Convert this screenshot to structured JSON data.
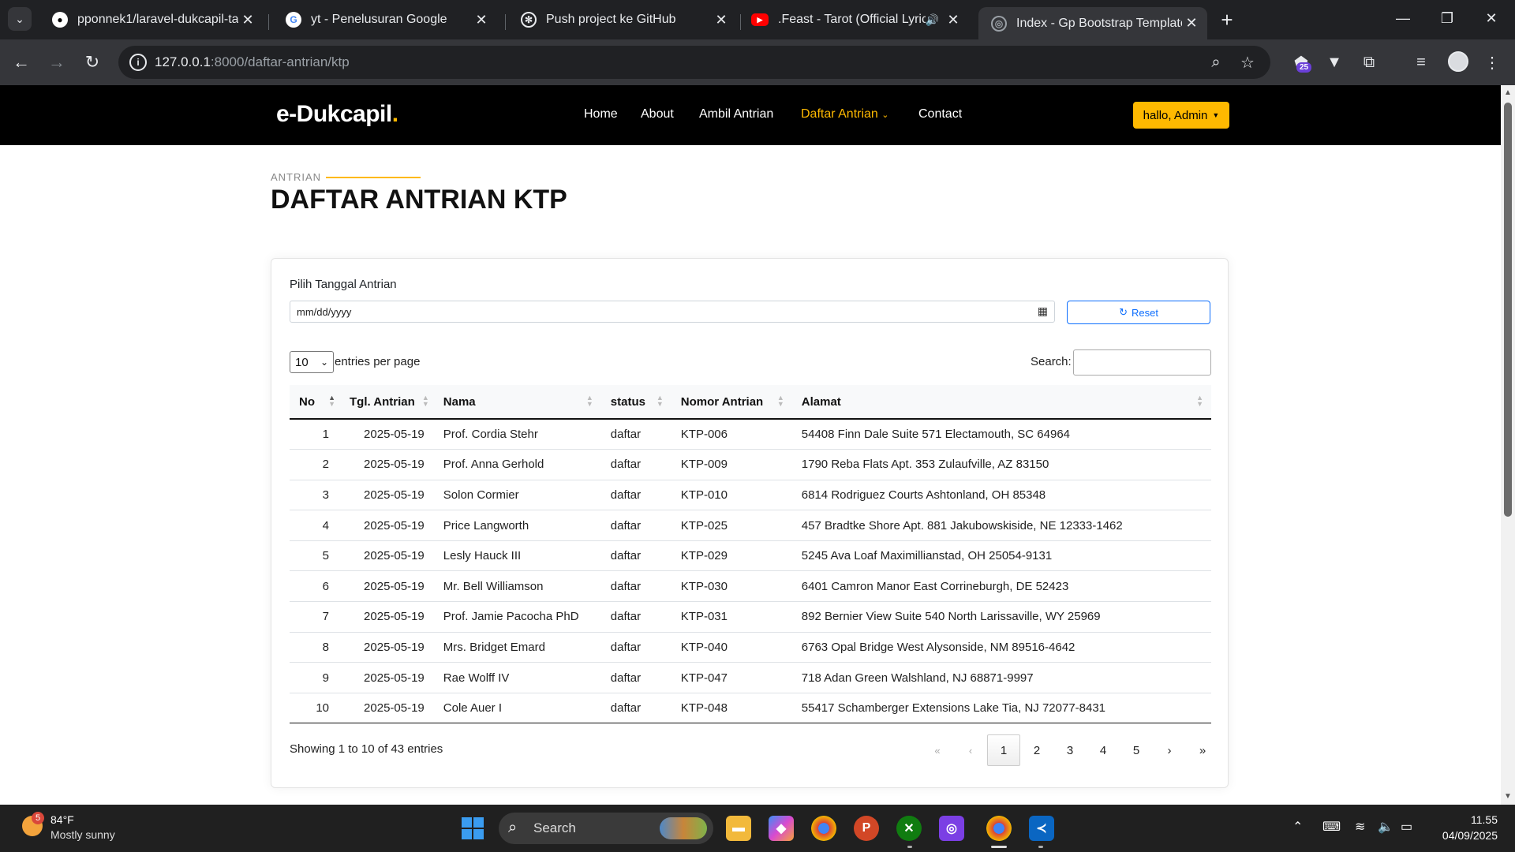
{
  "browser": {
    "tabs": [
      {
        "title": "pponnek1/laravel-dukcapil-ta",
        "icon": "github-icon"
      },
      {
        "title": "yt - Penelusuran Google",
        "icon": "google-icon"
      },
      {
        "title": "Push project ke GitHub",
        "icon": "chatgpt-icon"
      },
      {
        "title": ".Feast - Tarot (Official Lyric V",
        "icon": "youtube-icon"
      },
      {
        "title": "Index - Gp Bootstrap Template",
        "icon": "globe-icon"
      }
    ],
    "url_host": "127.0.0.1",
    "url_path": ":8000/daftar-antrian/ktp",
    "extension_badge": "25"
  },
  "site": {
    "logo": "e-Dukcapil",
    "logo_dot": ".",
    "nav": [
      "Home",
      "About",
      "Ambil Antrian",
      "Daftar Antrian",
      "Contact"
    ],
    "active_nav": "Daftar Antrian",
    "user_button": "hallo, Admin"
  },
  "page": {
    "eyebrow": "ANTRIAN",
    "title": "DAFTAR ANTRIAN KTP"
  },
  "filter": {
    "label": "Pilih Tanggal Antrian",
    "date_placeholder": "mm/dd/yyyy",
    "reset_label": "Reset"
  },
  "datatable": {
    "length_value": "10",
    "length_label": "entries per page",
    "search_label": "Search:",
    "columns": [
      "No",
      "Tgl. Antrian",
      "Nama",
      "status",
      "Nomor Antrian",
      "Alamat"
    ],
    "rows": [
      [
        "1",
        "2025-05-19",
        "Prof. Cordia Stehr",
        "daftar",
        "KTP-006",
        "54408 Finn Dale Suite 571 Electamouth, SC 64964"
      ],
      [
        "2",
        "2025-05-19",
        "Prof. Anna Gerhold",
        "daftar",
        "KTP-009",
        "1790 Reba Flats Apt. 353 Zulaufville, AZ 83150"
      ],
      [
        "3",
        "2025-05-19",
        "Solon Cormier",
        "daftar",
        "KTP-010",
        "6814 Rodriguez Courts Ashtonland, OH 85348"
      ],
      [
        "4",
        "2025-05-19",
        "Price Langworth",
        "daftar",
        "KTP-025",
        "457 Bradtke Shore Apt. 881 Jakubowskiside, NE 12333-1462"
      ],
      [
        "5",
        "2025-05-19",
        "Lesly Hauck III",
        "daftar",
        "KTP-029",
        "5245 Ava Loaf Maximillianstad, OH 25054-9131"
      ],
      [
        "6",
        "2025-05-19",
        "Mr. Bell Williamson",
        "daftar",
        "KTP-030",
        "6401 Camron Manor East Corrineburgh, DE 52423"
      ],
      [
        "7",
        "2025-05-19",
        "Prof. Jamie Pacocha PhD",
        "daftar",
        "KTP-031",
        "892 Bernier View Suite 540 North Larissaville, WY 25969"
      ],
      [
        "8",
        "2025-05-19",
        "Mrs. Bridget Emard",
        "daftar",
        "KTP-040",
        "6763 Opal Bridge West Alysonside, NM 89516-4642"
      ],
      [
        "9",
        "2025-05-19",
        "Rae Wolff IV",
        "daftar",
        "KTP-047",
        "718 Adan Green Walshland, NJ 68871-9997"
      ],
      [
        "10",
        "2025-05-19",
        "Cole Auer I",
        "daftar",
        "KTP-048",
        "55417 Schamberger Extensions Lake Tia, NJ 72077-8431"
      ]
    ],
    "info": "Showing 1 to 10 of 43 entries",
    "pagination": [
      "«",
      "‹",
      "1",
      "2",
      "3",
      "4",
      "5",
      "›",
      "»"
    ],
    "current_page": "1"
  },
  "taskbar": {
    "weather_badge": "5",
    "temperature": "84°F",
    "weather": "Mostly sunny",
    "search_label": "Search",
    "time": "11.55",
    "date": "04/09/2025"
  },
  "colors": {
    "accent": "#feb900",
    "header_bg": "#000000",
    "primary_blue": "#0d6efd"
  }
}
